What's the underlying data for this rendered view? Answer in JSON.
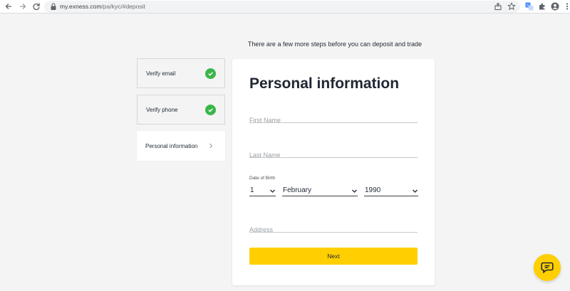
{
  "browser": {
    "url_domain": "my.exness.com",
    "url_path": "/pa/kyc/#deposit",
    "icons": [
      "back-icon",
      "forward-icon",
      "reload-icon",
      "lock-icon",
      "share-icon",
      "star-icon",
      "translate-icon",
      "extensions-icon",
      "profile-icon",
      "menu-icon"
    ]
  },
  "subtitle": "There are a few more steps before you can deposit and trade",
  "steps": [
    {
      "label": "Verify email",
      "status": "complete"
    },
    {
      "label": "Verify phone",
      "status": "complete"
    },
    {
      "label": "Personal information",
      "status": "current"
    }
  ],
  "form": {
    "title": "Personal information",
    "first_name_placeholder": "First Name",
    "last_name_placeholder": "Last Name",
    "dob_label": "Date of Birth",
    "dob_day": "1",
    "dob_month": "February",
    "dob_year": "1990",
    "address_placeholder": "Address",
    "next_label": "Next"
  },
  "colors": {
    "accent_yellow": "#ffcf01",
    "check_green": "#3bb54a",
    "text_dark": "#1f2733",
    "page_bg": "#f4f4f4"
  }
}
